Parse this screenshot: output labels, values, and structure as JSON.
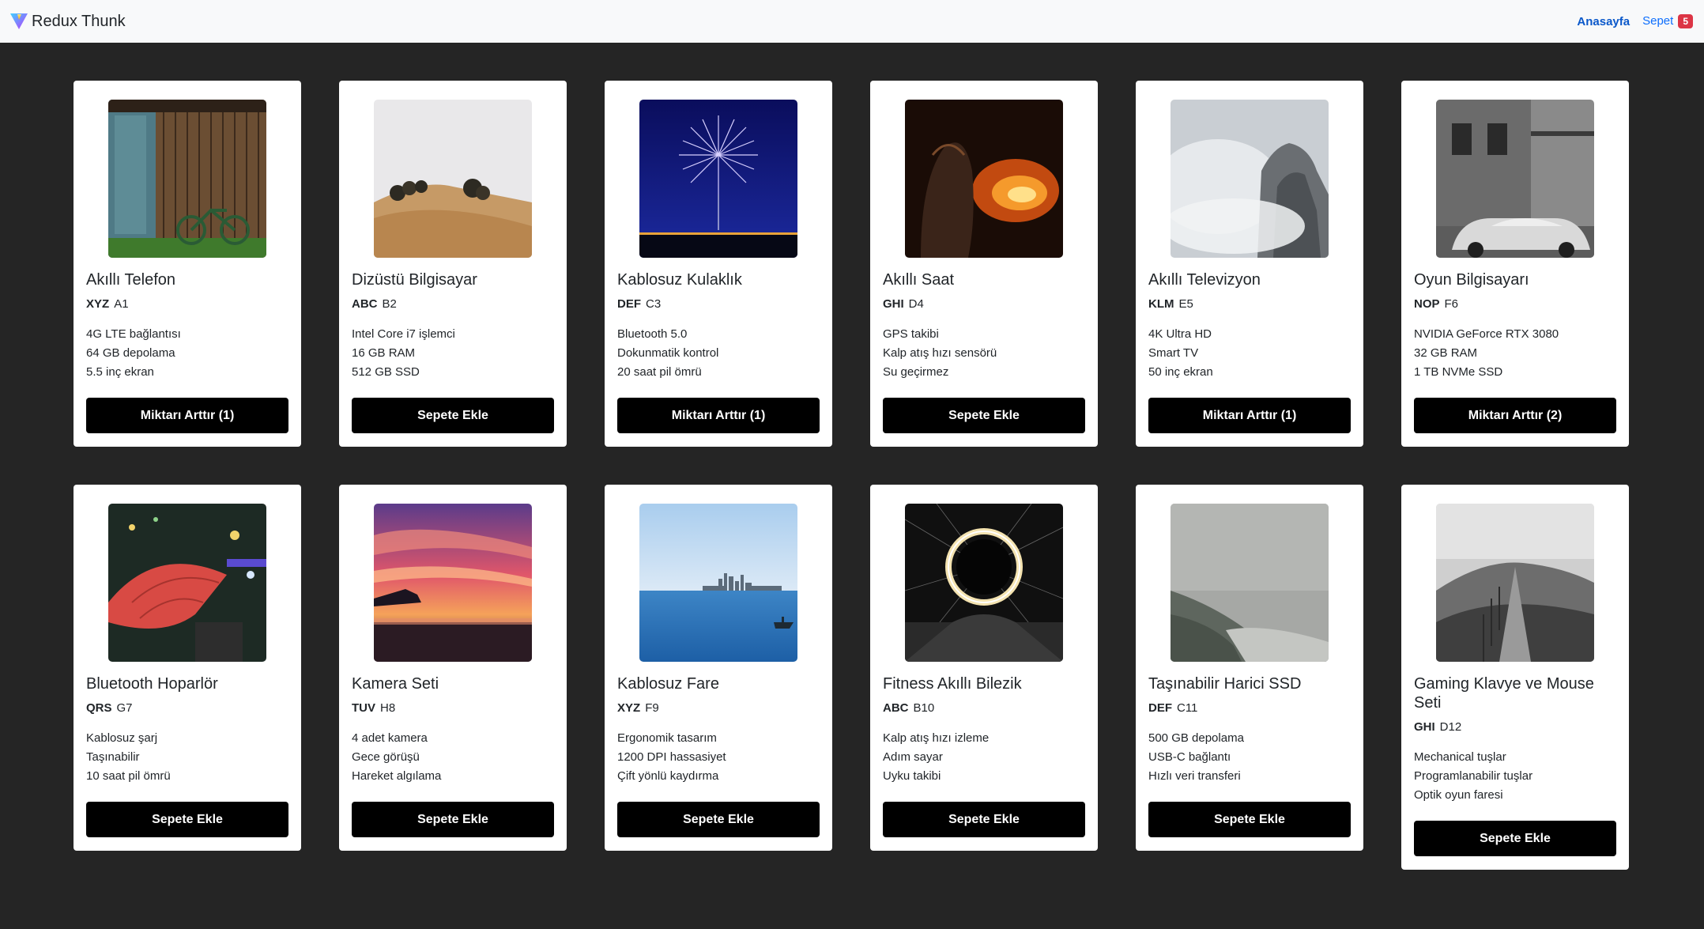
{
  "navbar": {
    "brand": "Redux Thunk",
    "home_label": "Anasayfa",
    "cart_label": "Sepet",
    "cart_count": "5"
  },
  "colors": {
    "cart_badge": "#dc3545",
    "nav_link": "#0d6efd",
    "page_background": "#252525",
    "button_background": "#000000"
  },
  "products": [
    {
      "title": "Akıllı Telefon",
      "brand": "XYZ",
      "model": "A1",
      "features": [
        "4G LTE bağlantısı",
        "64 GB depolama",
        "5.5 inç ekran"
      ],
      "button": "Miktarı Arttır (1)"
    },
    {
      "title": "Dizüstü Bilgisayar",
      "brand": "ABC",
      "model": "B2",
      "features": [
        "Intel Core i7 işlemci",
        "16 GB RAM",
        "512 GB SSD"
      ],
      "button": "Sepete Ekle"
    },
    {
      "title": "Kablosuz Kulaklık",
      "brand": "DEF",
      "model": "C3",
      "features": [
        "Bluetooth 5.0",
        "Dokunmatik kontrol",
        "20 saat pil ömrü"
      ],
      "button": "Miktarı Arttır (1)"
    },
    {
      "title": "Akıllı Saat",
      "brand": "GHI",
      "model": "D4",
      "features": [
        "GPS takibi",
        "Kalp atış hızı sensörü",
        "Su geçirmez"
      ],
      "button": "Sepete Ekle"
    },
    {
      "title": "Akıllı Televizyon",
      "brand": "KLM",
      "model": "E5",
      "features": [
        "4K Ultra HD",
        "Smart TV",
        "50 inç ekran"
      ],
      "button": "Miktarı Arttır (1)"
    },
    {
      "title": "Oyun Bilgisayarı",
      "brand": "NOP",
      "model": "F6",
      "features": [
        "NVIDIA GeForce RTX 3080",
        "32 GB RAM",
        "1 TB NVMe SSD"
      ],
      "button": "Miktarı Arttır (2)"
    },
    {
      "title": "Bluetooth Hoparlör",
      "brand": "QRS",
      "model": "G7",
      "features": [
        "Kablosuz şarj",
        "Taşınabilir",
        "10 saat pil ömrü"
      ],
      "button": "Sepete Ekle"
    },
    {
      "title": "Kamera Seti",
      "brand": "TUV",
      "model": "H8",
      "features": [
        "4 adet kamera",
        "Gece görüşü",
        "Hareket algılama"
      ],
      "button": "Sepete Ekle"
    },
    {
      "title": "Kablosuz Fare",
      "brand": "XYZ",
      "model": "F9",
      "features": [
        "Ergonomik tasarım",
        "1200 DPI hassasiyet",
        "Çift yönlü kaydırma"
      ],
      "button": "Sepete Ekle"
    },
    {
      "title": "Fitness Akıllı Bilezik",
      "brand": "ABC",
      "model": "B10",
      "features": [
        "Kalp atış hızı izleme",
        "Adım sayar",
        "Uyku takibi"
      ],
      "button": "Sepete Ekle"
    },
    {
      "title": "Taşınabilir Harici SSD",
      "brand": "DEF",
      "model": "C11",
      "features": [
        "500 GB depolama",
        "USB-C bağlantı",
        "Hızlı veri transferi"
      ],
      "button": "Sepete Ekle"
    },
    {
      "title": "Gaming Klavye ve Mouse Seti",
      "brand": "GHI",
      "model": "D12",
      "features": [
        "Mechanical tuşlar",
        "Programlanabilir tuşlar",
        "Optik oyun faresi"
      ],
      "button": "Sepete Ekle"
    }
  ]
}
